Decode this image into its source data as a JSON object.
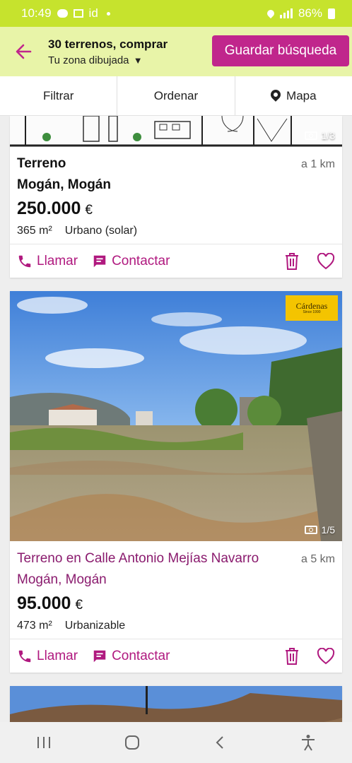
{
  "status_bar": {
    "time": "10:49",
    "carrier_label": "id",
    "battery": "86%"
  },
  "header": {
    "title": "30 terrenos, comprar",
    "subtitle": "Tu zona dibujada",
    "save_search": "Guardar búsqueda"
  },
  "toolbar": {
    "filter": "Filtrar",
    "sort": "Ordenar",
    "map": "Mapa"
  },
  "listings": [
    {
      "photo_count": "1/3",
      "title": "Terreno",
      "distance": "a 1 km",
      "location": "Mogán, Mogán",
      "price": "250.000",
      "currency": "€",
      "area": "365 m²",
      "type": "Urbano (solar)",
      "call": "Llamar",
      "contact": "Contactar"
    },
    {
      "photo_count": "1/5",
      "agency_logo": "Cárdenas",
      "agency_logo_sub": "Since 1990",
      "title": "Terreno en Calle Antonio Mejías Navarro",
      "distance": "a 5 km",
      "location": "Mogán, Mogán",
      "price": "95.000",
      "currency": "€",
      "area": "473 m²",
      "type": "Urbanizable",
      "call": "Llamar",
      "contact": "Contactar"
    }
  ],
  "colors": {
    "status_bar": "#c6e32d",
    "header_bg": "#e8f4a8",
    "accent": "#c0268c",
    "link": "#b0197f"
  }
}
